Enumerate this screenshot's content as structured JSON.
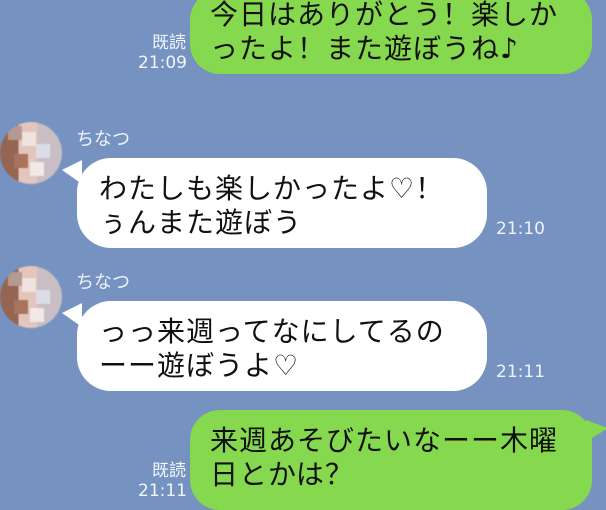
{
  "messages": [
    {
      "id": "m1",
      "direction": "outgoing",
      "read_label": "既読",
      "time": "21:09",
      "text": "今日はありがとう！楽しか\nったよ！また遊ぼうね♪"
    },
    {
      "id": "m2",
      "direction": "incoming",
      "sender": "ちなつ",
      "time": "21:10",
      "text": "わたしも楽しかったよ♡！\nぅんまた遊ぼう"
    },
    {
      "id": "m3",
      "direction": "incoming",
      "sender": "ちなつ",
      "time": "21:11",
      "text": "っっ来週ってなにしてるの\nーー遊ぼうよ♡"
    },
    {
      "id": "m4",
      "direction": "outgoing",
      "read_label": "既読",
      "time": "21:11",
      "text": "来週あそびたいなーー木曜\n日とかは？"
    }
  ],
  "colors": {
    "background": "#7592c1",
    "outgoing_bubble": "#86d84f",
    "incoming_bubble": "#ffffff"
  }
}
